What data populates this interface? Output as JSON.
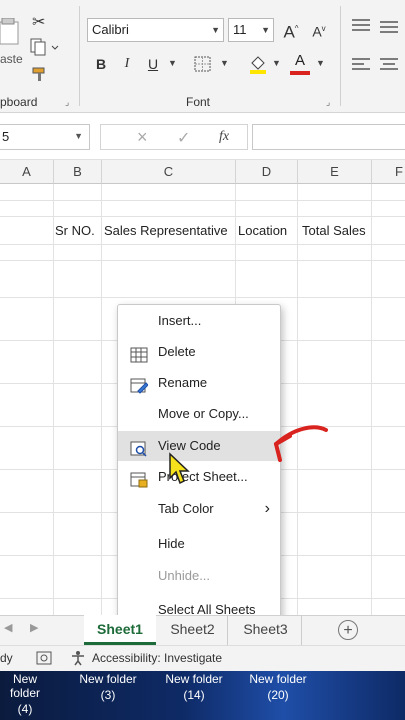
{
  "ribbon": {
    "clipboard": {
      "paste_label": "aste",
      "group_label": "pboard"
    },
    "font": {
      "font_name": "Calibri",
      "font_size": "11",
      "grow_label": "A",
      "shrink_label": "A",
      "bold_label": "B",
      "italic_label": "I",
      "underline_label": "U",
      "font_color_label": "A",
      "group_label": "Font"
    }
  },
  "formula_bar": {
    "name_box": "5",
    "cancel": "×",
    "enter": "✓",
    "fx": "fx",
    "value": ""
  },
  "grid": {
    "columns": [
      "A",
      "B",
      "C",
      "D",
      "E",
      "F"
    ],
    "headers": {
      "b": "Sr NO.",
      "c": "Sales Representative",
      "d": "Location",
      "e": "Total Sales"
    }
  },
  "context_menu": {
    "items": [
      {
        "label": "Insert...",
        "icon": ""
      },
      {
        "label": "Delete",
        "icon": "delete-sheet-icon"
      },
      {
        "label": "Rename",
        "icon": "rename-sheet-icon"
      },
      {
        "label": "Move or Copy...",
        "icon": ""
      },
      {
        "label": "View Code",
        "icon": "view-code-icon"
      },
      {
        "label": "Protect Sheet...",
        "icon": "protect-sheet-icon"
      },
      {
        "label": "Tab Color",
        "icon": ""
      },
      {
        "label": "Hide",
        "icon": ""
      },
      {
        "label": "Unhide...",
        "icon": ""
      },
      {
        "label": "Select All Sheets",
        "icon": ""
      }
    ],
    "submenu_arrow": "›"
  },
  "sheet_tabs": {
    "tabs": [
      "Sheet1",
      "Sheet2",
      "Sheet3"
    ],
    "active": "Sheet1",
    "add_label": "+"
  },
  "status_bar": {
    "ready": "dy",
    "accessibility": "Accessibility: Investigate"
  },
  "taskbar": {
    "items": [
      {
        "label": "New folder",
        "count": "(4)"
      },
      {
        "label": "New folder",
        "count": "(3)"
      },
      {
        "label": "New folder",
        "count": "(14)"
      },
      {
        "label": "New folder",
        "count": "(20)"
      }
    ]
  },
  "colors": {
    "excel_green": "#1e6b3a",
    "annotation_red": "#d9231f",
    "cursor_yellow": "#f5e11c"
  }
}
